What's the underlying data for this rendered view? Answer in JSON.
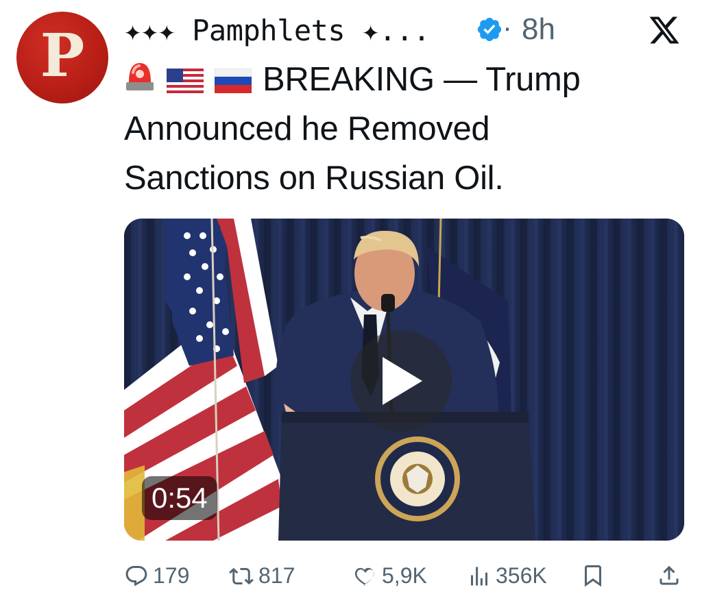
{
  "author": {
    "avatar_letter": "P",
    "display_name": "✦✦✦ Pamphlets ✦...",
    "verified_icon": "verified-badge-icon",
    "separator": "·",
    "time_ago": "8h",
    "platform_icon": "x-logo-icon"
  },
  "post": {
    "emojis": [
      "rotating-light-icon",
      "us-flag-icon",
      "russia-flag-icon"
    ],
    "text_line1": "BREAKING — Trump",
    "text_line2": "Announced he Removed",
    "text_line3": "Sanctions on Russian Oil."
  },
  "media": {
    "type": "video",
    "duration": "0:54",
    "play_icon": "play-icon"
  },
  "actions": {
    "replies": "179",
    "reposts": "817",
    "likes": "5,9K",
    "views": "356K",
    "bookmark_icon": "bookmark-icon",
    "share_icon": "share-icon"
  },
  "colors": {
    "text": "#0f1419",
    "secondary": "#536471",
    "verified": "#1d9bf0",
    "avatar": "#b81f17"
  }
}
